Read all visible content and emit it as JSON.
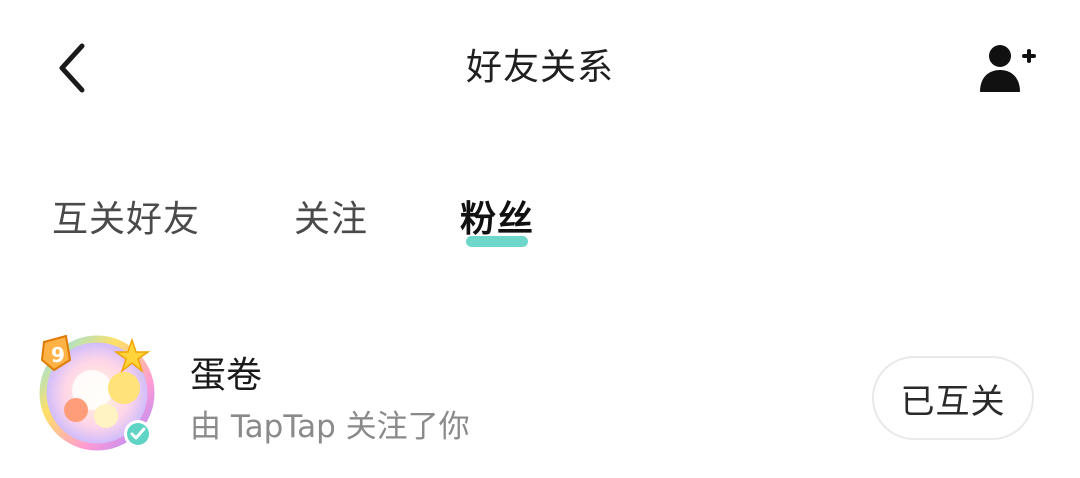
{
  "header": {
    "title": "好友关系",
    "back_icon": "chevron-left-icon",
    "add_friend_icon": "add-user-icon"
  },
  "tabs": [
    {
      "label": "互关好友",
      "active": false
    },
    {
      "label": "关注",
      "active": false
    },
    {
      "label": "粉丝",
      "active": true
    }
  ],
  "accent_color": "#5fd3c4",
  "list": {
    "items": [
      {
        "name": "蛋卷",
        "subtitle": "由 TapTap 关注了你",
        "button_label": "已互关",
        "avatar_icon": "avatar-image",
        "verified_icon": "verified-badge-icon"
      }
    ]
  }
}
